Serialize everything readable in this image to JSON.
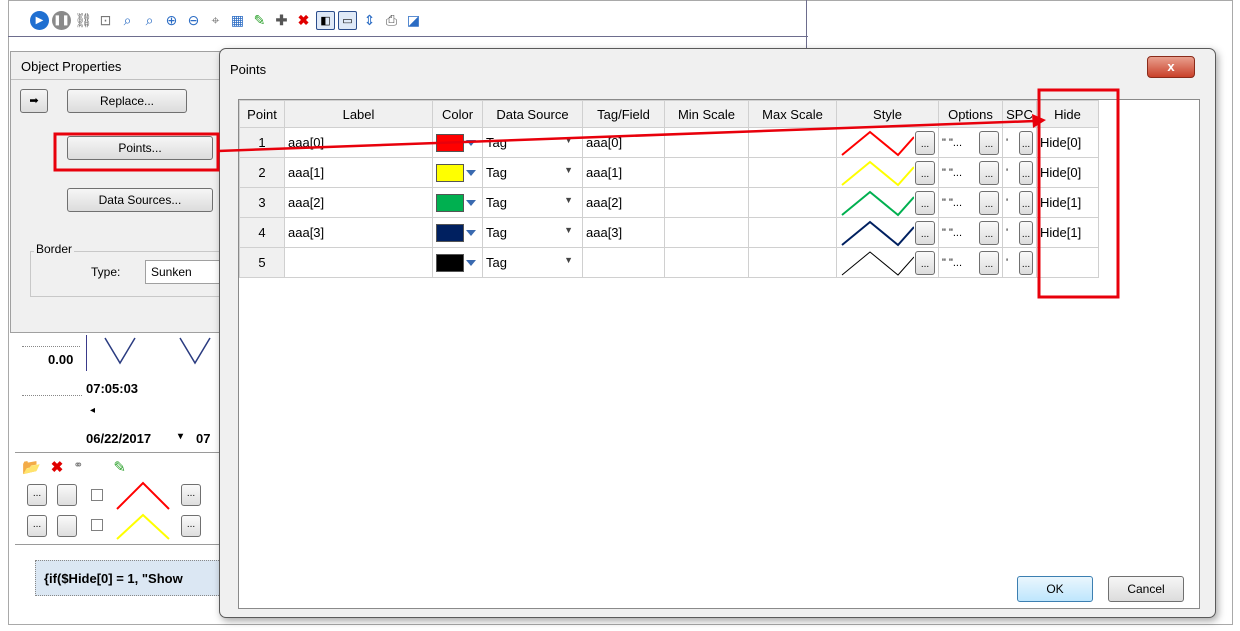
{
  "toolbar": {
    "icons": [
      "play-icon",
      "pause-icon",
      "link-icon",
      "zoom-window-icon",
      "zoom-area-icon",
      "zoom-time-icon",
      "zoom-in-icon",
      "zoom-out-icon",
      "zoom-reset-icon",
      "table-icon",
      "edit-icon",
      "add-icon",
      "delete-icon",
      "split-view-icon",
      "panel-view-icon",
      "scroll-icon",
      "print-icon",
      "chart-icon"
    ]
  },
  "object_properties": {
    "title": "Object Properties",
    "replace_label": "Replace...",
    "points_label": "Points...",
    "data_sources_label": "Data Sources...",
    "border_label": "Border",
    "type_label": "Type:",
    "type_value": "Sunken"
  },
  "background": {
    "y_value": "0.00",
    "time": "07:05:03",
    "date": "06/22/2017",
    "date_next": "07",
    "expression": "{if($Hide[0] = 1, \"Show"
  },
  "dialog": {
    "title": "Points",
    "close_label": "x",
    "columns": [
      "Point",
      "Label",
      "Color",
      "Data Source",
      "Tag/Field",
      "Min Scale",
      "Max Scale",
      "Style",
      "Options",
      "SPC",
      "Hide"
    ],
    "rows": [
      {
        "point": "1",
        "label": "aaa[0]",
        "color": "#ff0000",
        "data_source": "Tag",
        "tag": "aaa[0]",
        "min": "",
        "max": "",
        "options": "\" \"...",
        "spc": "'",
        "hide": "Hide[0]"
      },
      {
        "point": "2",
        "label": "aaa[1]",
        "color": "#ffff00",
        "data_source": "Tag",
        "tag": "aaa[1]",
        "min": "",
        "max": "",
        "options": "\" \"...",
        "spc": "'",
        "hide": "Hide[0]"
      },
      {
        "point": "3",
        "label": "aaa[2]",
        "color": "#00b050",
        "data_source": "Tag",
        "tag": "aaa[2]",
        "min": "",
        "max": "",
        "options": "\" \"...",
        "spc": "'",
        "hide": "Hide[1]"
      },
      {
        "point": "4",
        "label": "aaa[3]",
        "color": "#002060",
        "data_source": "Tag",
        "tag": "aaa[3]",
        "min": "",
        "max": "",
        "options": "\" \"...",
        "spc": "'",
        "hide": "Hide[1]"
      },
      {
        "point": "5",
        "label": "",
        "color": "#000000",
        "data_source": "Tag",
        "tag": "",
        "min": "",
        "max": "",
        "options": "\" \"...",
        "spc": "'",
        "hide": ""
      }
    ],
    "ellipsis": "...",
    "ok_label": "OK",
    "cancel_label": "Cancel"
  },
  "colors": {
    "annotation": "#e8000b",
    "accent": "#3c7fb1"
  }
}
